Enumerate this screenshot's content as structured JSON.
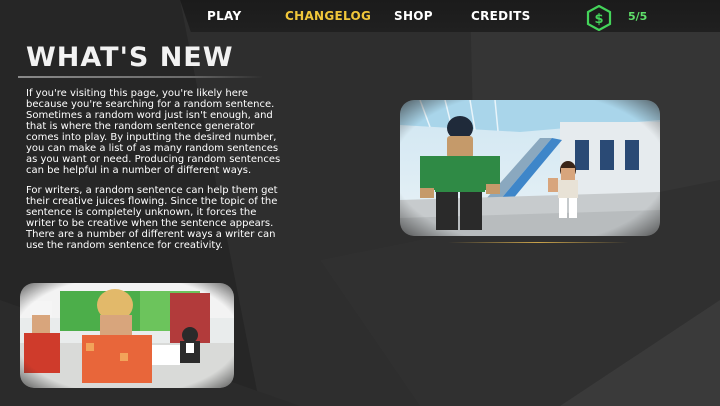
{
  "nav": {
    "items": [
      {
        "label": "PLAY",
        "active": false
      },
      {
        "label": "CHANGELOG",
        "active": true
      },
      {
        "label": "SHOP",
        "active": false
      },
      {
        "label": "CREDITS",
        "active": false
      }
    ],
    "currency_icon": "dollar-hexagon-icon",
    "currency_count": "5/5"
  },
  "page": {
    "title": "WHAT'S NEW",
    "paragraphs": [
      "If you're visiting this page, you're likely here because you're searching for a random sentence. Sometimes a random word just isn't enough, and that is where the random sentence generator comes into play. By inputting the desired number, you can make a list of as many random sentences as you want or need. Producing random sentences can be helpful in a number of different ways.",
      "For writers, a random sentence can help them get their creative juices flowing. Since the topic of the sentence is completely unknown, it forces the writer to be creative when the sentence appears. There are a number of different ways a writer can use the random sentence for creativity."
    ]
  },
  "colors": {
    "active_nav": "#f0c63a",
    "currency": "#5fe06a",
    "background": "#262626"
  }
}
